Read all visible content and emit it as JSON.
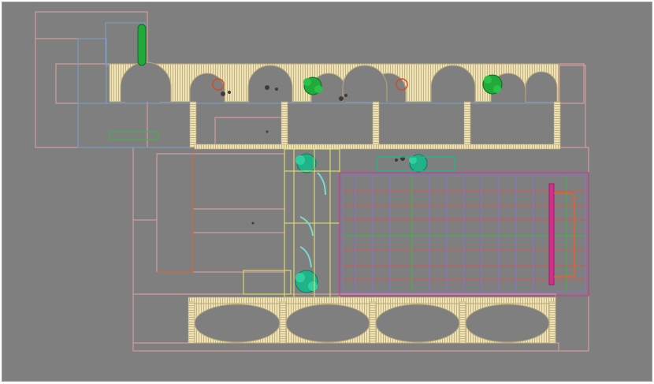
{
  "drawing": {
    "background": "#7f7f7f",
    "palette": {
      "wall_outline": "#e0a0a0",
      "interior_blue": "#7b9fc7",
      "wood_fill": "#efe2b4",
      "wood_stroke": "#b8a97a",
      "hedge_green": "#1faa3a",
      "shrub_teal": "#20b38a",
      "light_yellow": "#e8e86a",
      "grid_red": "#e0504a",
      "grid_violet": "#8f6fd0",
      "grid_green": "#3cb64a",
      "magenta": "#d0308a",
      "orange": "#e0662a",
      "dark_symbol": "#3c3c3c"
    },
    "elements": [
      "plan-outline",
      "arched-pergola-north",
      "arched-pergola-south",
      "hedge-planter",
      "round-shrubs",
      "circular-planters",
      "lighting-grid",
      "staircase-walkway"
    ]
  }
}
